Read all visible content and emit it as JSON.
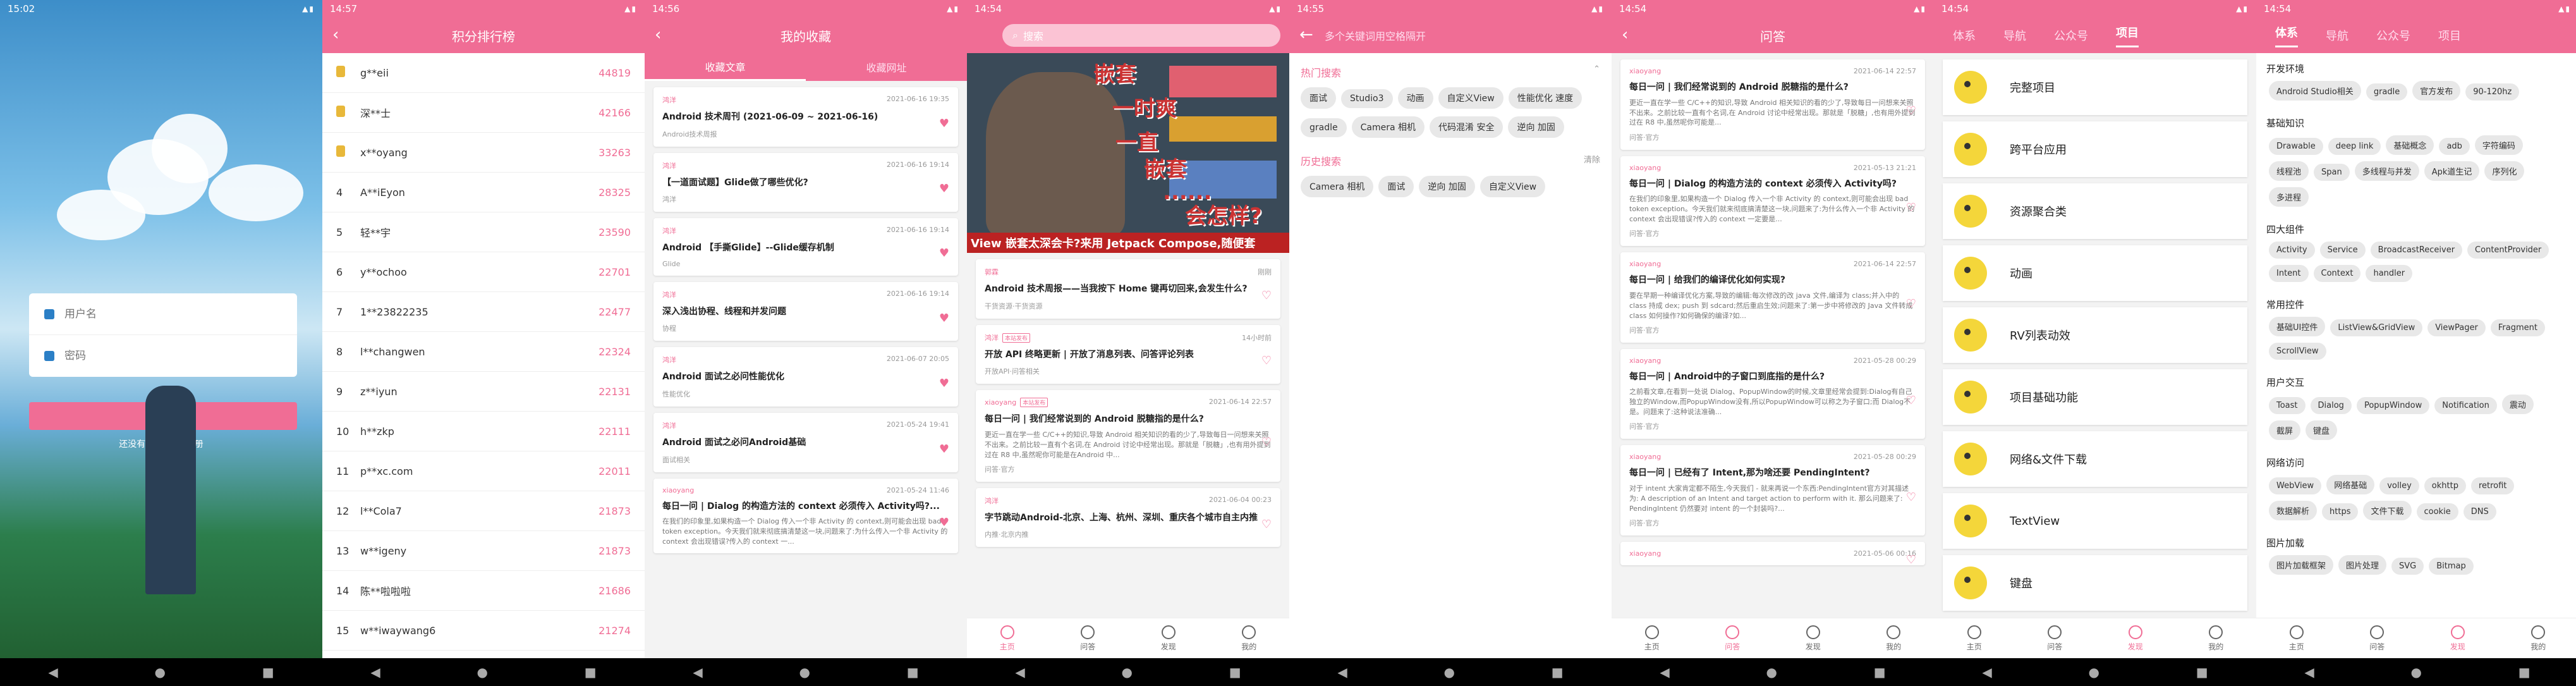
{
  "screens": {
    "login": {
      "status_time": "15:02",
      "username_placeholder": "用户名",
      "password_placeholder": "密码",
      "login_label": "登录",
      "register_text": "还没有账号?点击注册"
    },
    "rank": {
      "status_time": "14:57",
      "title": "积分排行榜",
      "rows": [
        {
          "rank": "",
          "name": "g**eii",
          "score": "44819"
        },
        {
          "rank": "",
          "name": "深**士",
          "score": "42166"
        },
        {
          "rank": "",
          "name": "x**oyang",
          "score": "33263"
        },
        {
          "rank": "4",
          "name": "A**iEyon",
          "score": "28325"
        },
        {
          "rank": "5",
          "name": "轻**宇",
          "score": "23590"
        },
        {
          "rank": "6",
          "name": "y**ochoo",
          "score": "22701"
        },
        {
          "rank": "7",
          "name": "1**23822235",
          "score": "22477"
        },
        {
          "rank": "8",
          "name": "l**changwen",
          "score": "22324"
        },
        {
          "rank": "9",
          "name": "z**iyun",
          "score": "22131"
        },
        {
          "rank": "10",
          "name": "h**zkp",
          "score": "22111"
        },
        {
          "rank": "11",
          "name": "p**xc.com",
          "score": "22011"
        },
        {
          "rank": "12",
          "name": "l**Cola7",
          "score": "21873"
        },
        {
          "rank": "13",
          "name": "w**igeny",
          "score": "21873"
        },
        {
          "rank": "14",
          "name": "陈**啦啦啦",
          "score": "21686"
        },
        {
          "rank": "15",
          "name": "w**iwaywang6",
          "score": "21274"
        }
      ]
    },
    "collect": {
      "status_time": "14:56",
      "title": "我的收藏",
      "tab_articles": "收藏文章",
      "tab_sites": "收藏网址",
      "cards": [
        {
          "author": "鸿洋",
          "date": "2021-06-16 19:35",
          "title": "Android 技术周刊 (2021-06-09 ~ 2021-06-16)",
          "cat": "Android技术周报",
          "desc": ""
        },
        {
          "author": "鸿洋",
          "date": "2021-06-16 19:14",
          "title": "【一道面试题】Glide做了哪些优化?",
          "cat": "鸿洋",
          "desc": ""
        },
        {
          "author": "鸿洋",
          "date": "2021-06-16 19:14",
          "title": "Android 【手撕Glide】--Glide缓存机制",
          "cat": "Glide",
          "desc": ""
        },
        {
          "author": "鸿洋",
          "date": "2021-06-16 19:14",
          "title": "深入浅出协程、线程和并发问题",
          "cat": "协程",
          "desc": ""
        },
        {
          "author": "鸿洋",
          "date": "2021-06-07 20:05",
          "title": "Android 面试之必问性能优化",
          "cat": "性能优化",
          "desc": ""
        },
        {
          "author": "鸿洋",
          "date": "2021-05-24 19:41",
          "title": "Android 面试之必问Android基础",
          "cat": "面试相关",
          "desc": ""
        },
        {
          "author": "xiaoyang",
          "date": "2021-05-24 11:46",
          "title": "每日一问 | Dialog 的构造方法的 context 必须传入 Activity吗?...",
          "cat": "",
          "desc": "在我们的印象里,如果构造一个 Dialog 传入一个非 Activity 的 context,则可能会出现 bad token exception。今天我们就来彻底搞清楚这一块,问题来了:为什么传入一个非 Activity 的 context 会出现错误?传入的 context 一..."
        }
      ]
    },
    "home": {
      "status_time": "14:54",
      "search_placeholder": "搜索",
      "banner_title": "View 嵌套太深会卡?来用 Jetpack Compose,随便套",
      "banner_labels": [
        "嵌套",
        "一时爽",
        "一直",
        "嵌套",
        "......",
        "会怎样?"
      ],
      "cards": [
        {
          "author": "郭霖",
          "date": "刚刚",
          "title": "Android 技术周报——当我按下 Home 键再切回来,会发生什么?",
          "cat": "干货资源·干货资源",
          "desc": "",
          "tag": ""
        },
        {
          "author": "鸿洋",
          "date": "14小时前",
          "title": "开放 API 终略更新 | 开放了消息列表、问答评论列表",
          "cat": "开放API·问答相关",
          "desc": "",
          "tag": "本站发布"
        },
        {
          "author": "xiaoyang",
          "date": "2021-06-14 22:57",
          "title": "每日一问 | 我们经常说到的 Android 脱糖指的是什么?",
          "cat": "问答·官方",
          "desc": "更近一直在学一些 C/C++的知识,导致 Android 相关知识的看的少了,导致每日一问想来关照不出来。之前比较一直有个名词,在 Android 讨论中经常出现。那就是「脱糖」,也有用外提到过在 R8 中,虽然呢你可能是在Android 中...",
          "tag": "本站发布"
        },
        {
          "author": "鸿洋",
          "date": "2021-06-04 00:23",
          "title": "字节跳动Android-北京、上海、杭州、深圳、重庆各个城市自主内推",
          "cat": "内推·北京内推",
          "desc": "",
          "tag": ""
        }
      ]
    },
    "search": {
      "status_time": "14:55",
      "placeholder": "多个关键词用空格隔开",
      "hot_title": "热门搜索",
      "hot": [
        "面试",
        "Studio3",
        "动画",
        "自定义View",
        "性能优化 速度",
        "gradle",
        "Camera 相机",
        "代码混淆 安全",
        "逆向 加固"
      ],
      "history_title": "历史搜索",
      "clear_label": "清除",
      "history": [
        "Camera 相机",
        "面试",
        "逆向 加固",
        "自定义View"
      ]
    },
    "qa": {
      "status_time": "14:54",
      "title": "问答",
      "cards": [
        {
          "author": "xiaoyang",
          "date": "2021-06-14 22:57",
          "title": "每日一问 | 我们经常说到的 Android 脱糖指的是什么?",
          "desc": "更近一直在学一些 C/C++的知识,导致 Android 相关知识的看的少了,导致每日一问想来关照不出来。之前比较一直有个名词,在 Android 讨论中经常出现。那就是「脱糖」,也有用外提到过在 R8 中,虽然呢你可能是...",
          "cat": "问答·官方"
        },
        {
          "author": "xiaoyang",
          "date": "2021-05-13 21:21",
          "title": "每日一问 | Dialog 的构造方法的 context 必须传入 Activity吗?",
          "desc": "在我们的印象里,如果构造一个 Dialog 传入一个非 Activity 的 context,则可能会出现 bad token exception。今天我们就来彻底搞清楚这一块,问题来了:为什么传入一个非 Activity 的 context 会出现错误?传入的 context 一定要是...",
          "cat": "问答·官方"
        },
        {
          "author": "xiaoyang",
          "date": "2021-06-14 22:57",
          "title": "每日一问 | 给我们的编译优化如何实现?",
          "desc": "要在早期一种编译优化方案,导致的编辑:每次修改的改 java 文件,编译为 class;并入中的 class 持成 dex; push 到 sdcard;然后重启生效;问题来了:第一步中将修改的 Java 文件转成 class 如何操作?如何确保的编译?如...",
          "cat": "问答·官方"
        },
        {
          "author": "xiaoyang",
          "date": "2021-05-28 00:29",
          "title": "每日一问 | Android中的子窗口到底指的是什么?",
          "desc": "之前看文章,在看到一处说 Dialog、PopupWindow的时候,文章里经常会提到:Dialog有自己独立的Window,而PopupWindow没有,所以PopupWindow可以称之为子窗口;而 Dialog不是。问题来了:这种说法准确...",
          "cat": "问答·官方"
        },
        {
          "author": "xiaoyang",
          "date": "2021-05-28 00:29",
          "title": "每日一问 | 已经有了 Intent,那为啥还要 PendingIntent?",
          "desc": "对于 intent 大家肯定都不陌生,今天我们 - 就来再说一个东西:PendingIntent官方对其描述为: A description of an Intent and target action to perform with it. 那么问题来了: PendingIntent 仍然要对 intent 的一个封装吗?...",
          "cat": "问答·官方"
        },
        {
          "author": "xiaoyang",
          "date": "2021-05-06 00:16",
          "title": "",
          "desc": "",
          "cat": ""
        }
      ]
    },
    "project": {
      "status_time": "14:54",
      "tabs": [
        "体系",
        "导航",
        "公众号",
        "项目"
      ],
      "items": [
        "完整项目",
        "跨平台应用",
        "资源聚合类",
        "动画",
        "RV列表动效",
        "项目基础功能",
        "网络&文件下载",
        "TextView",
        "键盘"
      ]
    },
    "system": {
      "status_time": "14:54",
      "tabs": [
        "体系",
        "导航",
        "公众号",
        "项目"
      ],
      "groups": [
        {
          "title": "开发环境",
          "chips": [
            "Android Studio相关",
            "gradle",
            "官方发布",
            "90-120hz"
          ]
        },
        {
          "title": "基础知识",
          "chips": [
            "Drawable",
            "deep link",
            "基础概念",
            "adb",
            "字符编码",
            "线程池",
            "Span",
            "多线程与并发",
            "Apk道生记",
            "序列化",
            "多进程"
          ]
        },
        {
          "title": "四大组件",
          "chips": [
            "Activity",
            "Service",
            "BroadcastReceiver",
            "ContentProvider",
            "Intent",
            "Context",
            "handler"
          ]
        },
        {
          "title": "常用控件",
          "chips": [
            "基础UI控件",
            "ListView&GridView",
            "ViewPager",
            "Fragment",
            "ScrollView"
          ]
        },
        {
          "title": "用户交互",
          "chips": [
            "Toast",
            "Dialog",
            "PopupWindow",
            "Notification",
            "震动",
            "截屏",
            "键盘"
          ]
        },
        {
          "title": "网络访问",
          "chips": [
            "WebView",
            "网络基础",
            "volley",
            "okhttp",
            "retrofit",
            "数据解析",
            "https",
            "文件下载",
            "cookie",
            "DNS"
          ]
        },
        {
          "title": "图片加载",
          "chips": [
            "图片加载框架",
            "图片处理",
            "SVG",
            "Bitmap"
          ]
        }
      ]
    },
    "bottom_tabs": [
      "主页",
      "问答",
      "发现",
      "我的"
    ]
  }
}
